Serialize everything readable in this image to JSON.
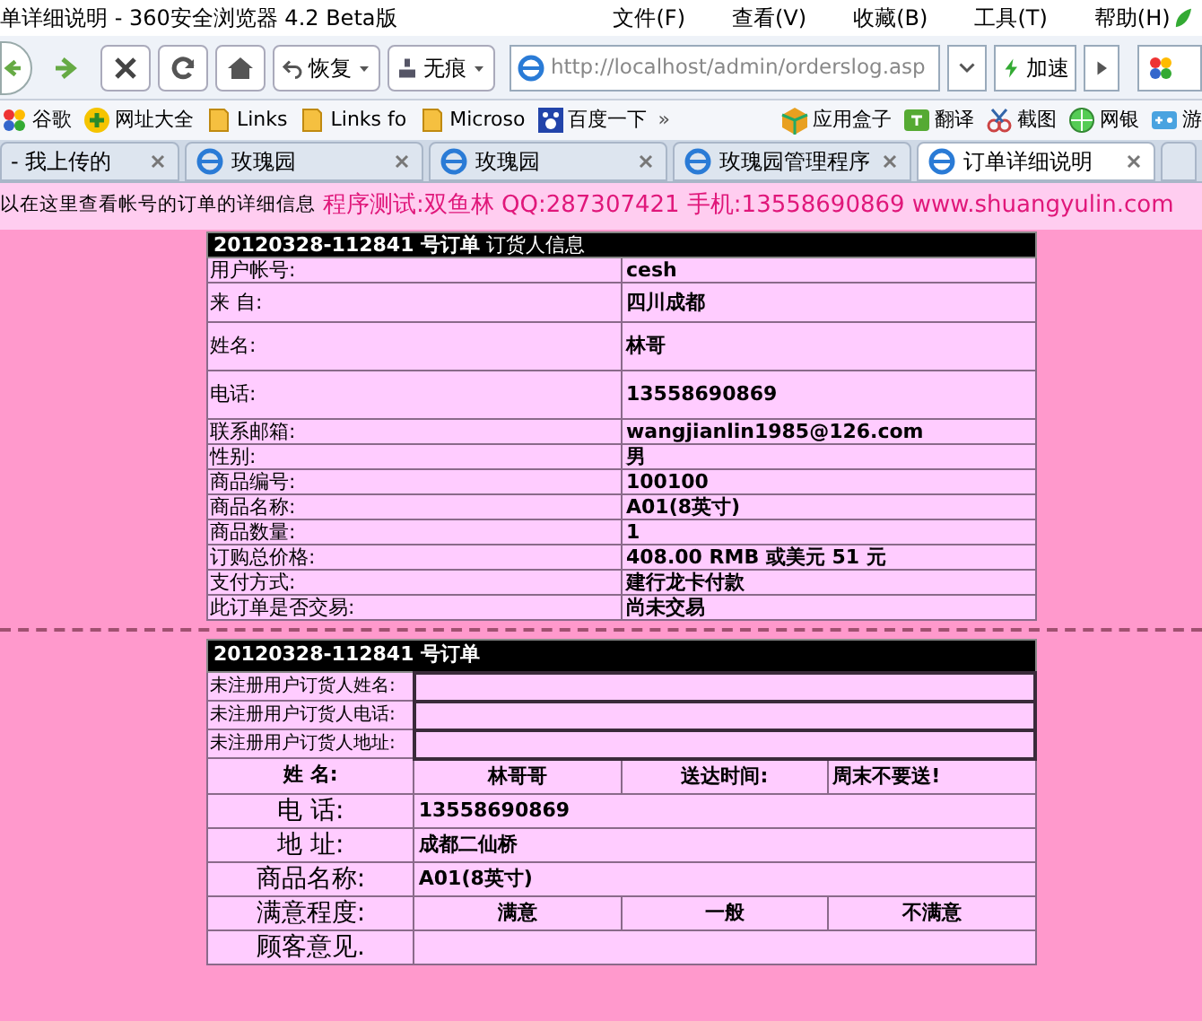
{
  "window": {
    "title": "单详细说明 - 360安全浏览器 4.2 Beta版"
  },
  "menu": [
    "文件(F)",
    "查看(V)",
    "收藏(B)",
    "工具(T)",
    "帮助(H)"
  ],
  "toolbar": {
    "restore": "恢复",
    "private": "无痕",
    "address": "http://localhost/admin/orderslog.asp",
    "speedup": "加速"
  },
  "bookmarks": [
    {
      "label": "谷歌",
      "kind": "google"
    },
    {
      "label": "网址大全",
      "kind": "plus"
    },
    {
      "label": "Links",
      "kind": "folder"
    },
    {
      "label": "Links fo",
      "kind": "folder"
    },
    {
      "label": "Microso",
      "kind": "folder"
    },
    {
      "label": "百度一下",
      "kind": "paw"
    }
  ],
  "overflow": "»",
  "tools": [
    {
      "label": "应用盒子",
      "kind": "box"
    },
    {
      "label": "翻译",
      "kind": "translate"
    },
    {
      "label": "截图",
      "kind": "scissors"
    },
    {
      "label": "网银",
      "kind": "globe"
    },
    {
      "label": "游",
      "kind": "game"
    }
  ],
  "tabs": [
    {
      "label": "- 我上传的",
      "selected": false,
      "icon": false
    },
    {
      "label": "玫瑰园",
      "selected": false,
      "icon": true
    },
    {
      "label": "玫瑰园",
      "selected": false,
      "icon": true
    },
    {
      "label": "玫瑰园管理程序",
      "selected": false,
      "icon": true
    },
    {
      "label": "订单详细说明",
      "selected": true,
      "icon": true
    }
  ],
  "notice": {
    "left": "以在这里查看帐号的订单的详细信息",
    "right": "程序测试:双鱼林 QQ:287307421 手机:13558690869 www.shuangyulin.com"
  },
  "customer_table": {
    "order": "20120328-112841 号订单",
    "caption": "订货人信息",
    "rows": [
      {
        "label": "用户帐号:",
        "value": "cesh"
      },
      {
        "label": "来 自:",
        "value": "四川成都"
      },
      {
        "label": "姓名:",
        "value": "林哥"
      },
      {
        "label": "电话:",
        "value": "13558690869"
      },
      {
        "label": "联系邮箱:",
        "value": "wangjianlin1985@126.com"
      },
      {
        "label": "性别:",
        "value": "男"
      },
      {
        "label": "商品编号:",
        "value": "100100"
      },
      {
        "label": "商品名称:",
        "value": "A01(8英寸)"
      },
      {
        "label": "商品数量:",
        "value": "1"
      },
      {
        "label": "订购总价格:",
        "value": "408.00 RMB 或美元  51 元"
      },
      {
        "label": "支付方式:",
        "value": "建行龙卡付款"
      },
      {
        "label": "此订单是否交易:",
        "value": "尚未交易"
      }
    ]
  },
  "order_table": {
    "order": "20120328-112841 号订单",
    "fields": [
      "未注册用户订货人姓名:",
      "未注册用户订货人电话:",
      "未注册用户订货人地址:"
    ],
    "name_row": [
      "姓 名:",
      "林哥哥",
      "送达时间:",
      "周末不要送!"
    ],
    "rows": [
      {
        "label": "电 话:",
        "value": "13558690869"
      },
      {
        "label": "地 址:",
        "value": "成都二仙桥"
      },
      {
        "label": "商品名称:",
        "value": "A01(8英寸)"
      }
    ],
    "rating": {
      "label": "满意程度:",
      "options": [
        "满意",
        "一般",
        "不满意"
      ]
    },
    "comment_label": "顾客意见."
  }
}
